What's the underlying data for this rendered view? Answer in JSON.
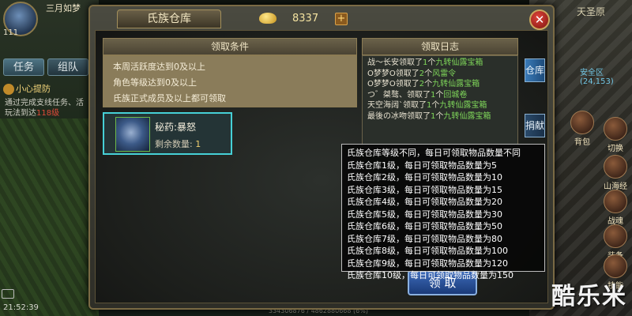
{
  "hud": {
    "player_name": "三月如梦",
    "level": "111",
    "tabs": [
      "任务",
      "组队"
    ],
    "quest_title": "小心提防",
    "quest_desc_1": "通过完成支线任务、活",
    "quest_desc_2": "玩法到达",
    "quest_desc_level": "118级",
    "clock": "21:52:39",
    "coords": "334306876 / 4862880668 (6%)"
  },
  "right_hud": {
    "map_name": "天圣原",
    "map_coord": "安全区(24,153)",
    "buttons": [
      "背包",
      "切换",
      "山海经",
      "战魂",
      "装备",
      "技能"
    ]
  },
  "dialog": {
    "title": "氏族仓库",
    "gold": "8337",
    "plus_label": "+",
    "close_label": "✕",
    "conditions_header": "领取条件",
    "conditions": [
      "本周活跃度达到0及以上",
      "角色等级达到0及以上",
      "氏族正式成员及以上都可领取"
    ],
    "item": {
      "name": "秘药:暴怒",
      "qty_label": "剩余数量:",
      "qty": "1"
    },
    "log_header": "领取日志",
    "log": [
      {
        "name": "战～长安",
        "act": "领取了",
        "count": "1",
        "unit": "个",
        "item": "九转仙露宝箱"
      },
      {
        "name": "O梦梦O",
        "act": "领取了",
        "count": "2",
        "unit": "个",
        "item": "风雷令"
      },
      {
        "name": "O梦梦O",
        "act": "领取了",
        "count": "2",
        "unit": "个",
        "item": "九转仙露宝箱"
      },
      {
        "name": "つ゛桀骜、",
        "act": "领取了",
        "count": "1",
        "unit": "个",
        "item": "回城卷"
      },
      {
        "name": "天空海阔`",
        "act": "领取了",
        "count": "1",
        "unit": "个",
        "item": "九转仙露宝箱"
      },
      {
        "name": "最後の冰吻",
        "act": "领取了",
        "count": "1",
        "unit": "个",
        "item": "九转仙露宝箱"
      }
    ],
    "side_tabs": [
      "仓库",
      "捐献"
    ],
    "claim_label": "领 取"
  },
  "tooltip": [
    "氏族仓库等级不同，每日可领取物品数量不同",
    "氏族仓库1级，每日可领取物品数量为5",
    "氏族仓库2级，每日可领取物品数量为10",
    "氏族仓库3级，每日可领取物品数量为15",
    "氏族仓库4级，每日可领取物品数量为20",
    "氏族仓库5级，每日可领取物品数量为30",
    "氏族仓库6级，每日可领取物品数量为50",
    "氏族仓库7级，每日可领取物品数量为80",
    "氏族仓库8级，每日可领取物品数量为100",
    "氏族仓库9级，每日可领取物品数量为120",
    "氏族仓库10级，每日可领取物品数量为150"
  ],
  "watermark": "酷乐米"
}
